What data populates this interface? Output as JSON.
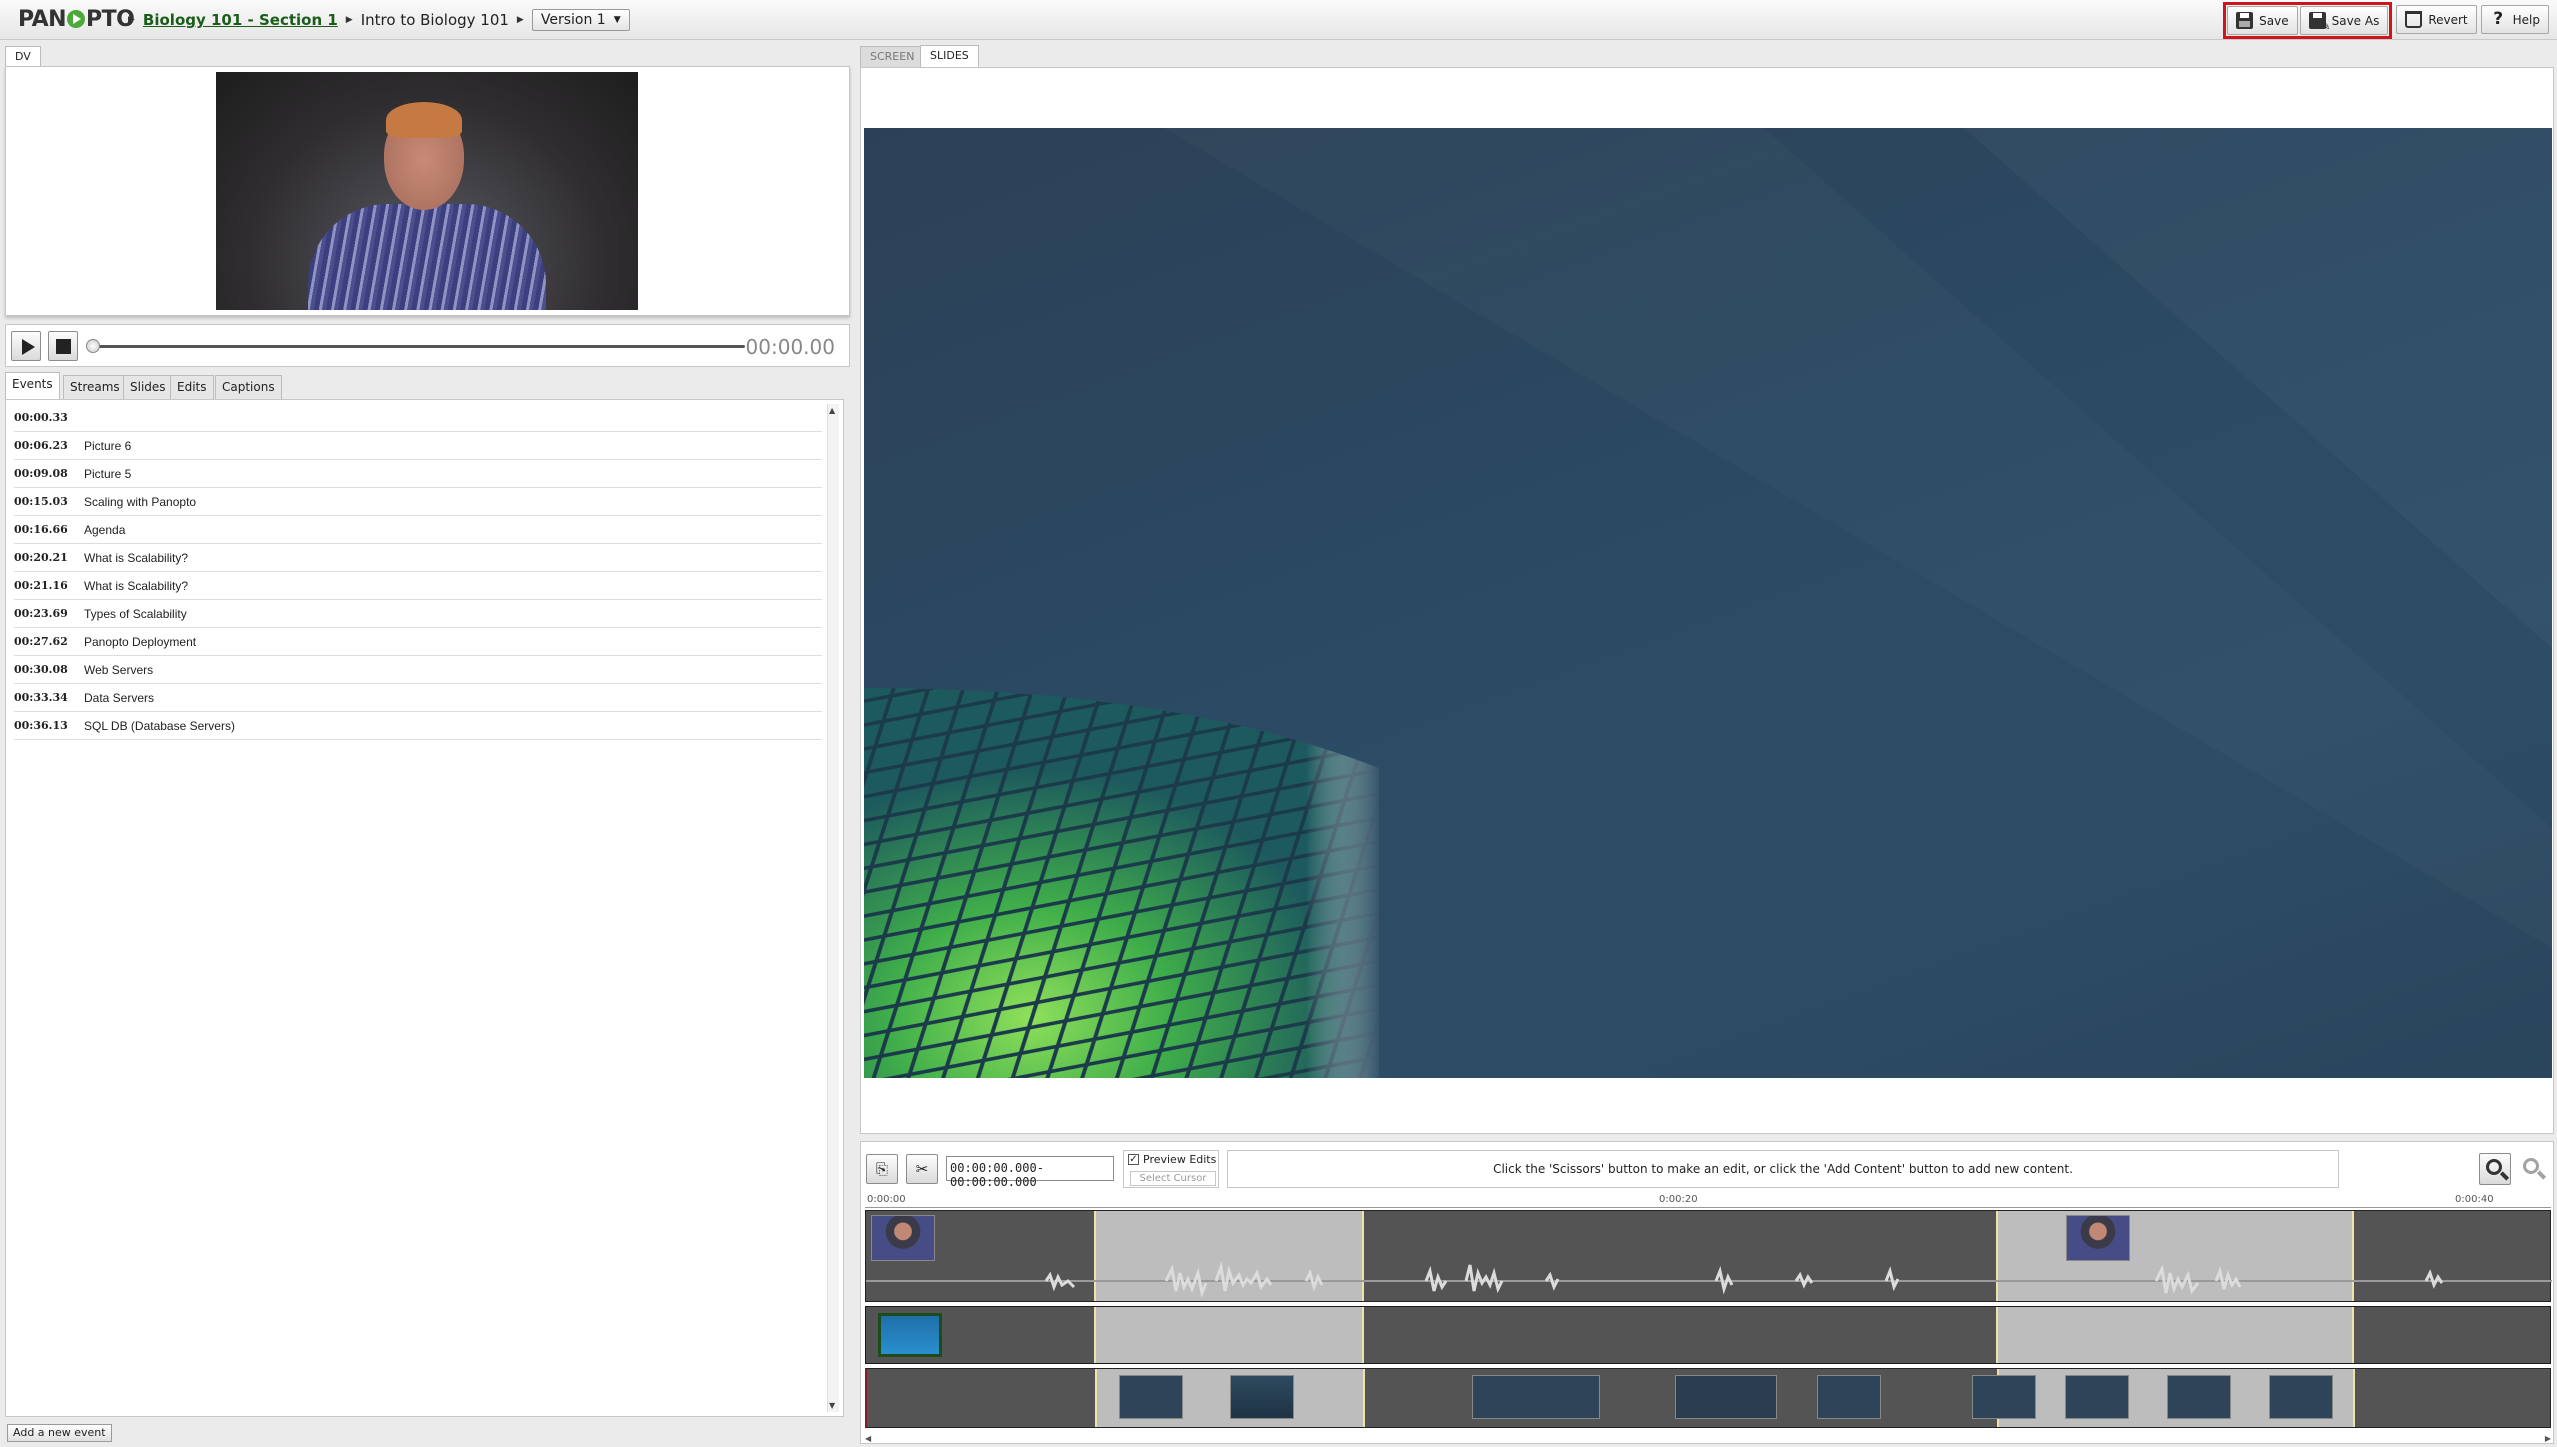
{
  "header": {
    "logo": "PAN",
    "logo_suffix": "PTO",
    "breadcrumb": {
      "folder": "Biology 101 - Section 1",
      "session": "Intro to Biology 101"
    },
    "version": "Version 1",
    "buttons": {
      "save": "Save",
      "save_as": "Save As",
      "revert": "Revert",
      "help": "Help"
    }
  },
  "left": {
    "video_tab": "DV",
    "timecode": "00:00.00",
    "tabs": [
      "Events",
      "Streams",
      "Slides",
      "Edits",
      "Captions"
    ],
    "events": [
      {
        "time": "00:00.33",
        "title": ""
      },
      {
        "time": "00:06.23",
        "title": "Picture 6"
      },
      {
        "time": "00:09.08",
        "title": "Picture 5"
      },
      {
        "time": "00:15.03",
        "title": "Scaling with Panopto"
      },
      {
        "time": "00:16.66",
        "title": "Agenda"
      },
      {
        "time": "00:20.21",
        "title": "What is Scalability?"
      },
      {
        "time": "00:21.16",
        "title": "What is Scalability?"
      },
      {
        "time": "00:23.69",
        "title": "Types of Scalability"
      },
      {
        "time": "00:27.62",
        "title": "Panopto Deployment"
      },
      {
        "time": "00:30.08",
        "title": "Web Servers"
      },
      {
        "time": "00:33.34",
        "title": "Data Servers"
      },
      {
        "time": "00:36.13",
        "title": "SQL DB (Database Servers)"
      }
    ],
    "add_event": "Add a new event"
  },
  "right": {
    "tabs": [
      "SCREEN",
      "SLIDES"
    ],
    "active_tab": "SLIDES"
  },
  "timeline": {
    "range": "00:00:00.000-00:00:00.000",
    "preview_edits": "Preview Edits",
    "preview_checked": "✓",
    "select_cursor": "Select Cursor",
    "hint": "Click the 'Scissors' button to make an edit, or click the 'Add Content' button to add new content.",
    "ruler": [
      "0:00:00",
      "0:00:20",
      "0:00:40"
    ]
  },
  "colors": {
    "accent_red": "#d0141b",
    "brand_green": "#4caa3c",
    "slide_bg": "#2b4a63"
  }
}
